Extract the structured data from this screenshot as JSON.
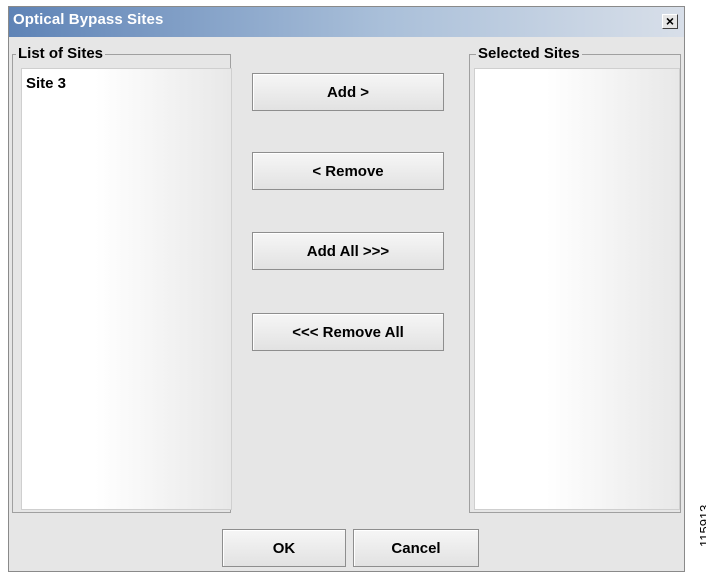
{
  "window": {
    "title": "Optical Bypass Sites",
    "close_glyph": "×",
    "close_icon": "close-icon"
  },
  "left_panel": {
    "legend": "List of Sites",
    "items": [
      {
        "label": "Site 3"
      }
    ]
  },
  "right_panel": {
    "legend": "Selected Sites",
    "items": []
  },
  "transfer_buttons": {
    "add": "Add >",
    "remove": "< Remove",
    "add_all": "Add All >>>",
    "remove_all": "<<< Remove All"
  },
  "footer_buttons": {
    "ok": "OK",
    "cancel": "Cancel"
  },
  "figure_id": "115913",
  "colors": {
    "title_bar_start": "#5e83b6",
    "dialog_background": "#e6e6e6",
    "title_text": "#ffffff"
  }
}
